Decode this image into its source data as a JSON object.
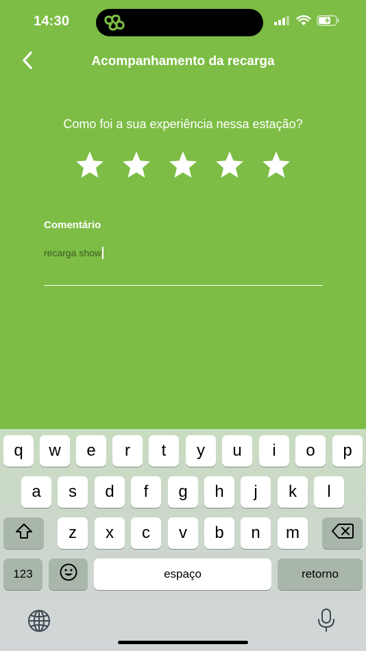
{
  "status_bar": {
    "time": "14:30",
    "icons": [
      "link-rings-icon",
      "cellular-signal-icon",
      "wifi-icon",
      "battery-charging-icon"
    ]
  },
  "header": {
    "title": "Acompanhamento da recarga",
    "back_icon": "chevron-left-icon"
  },
  "rating": {
    "question": "Como foi a sua experiência nessa estação?",
    "value": 5,
    "max": 5
  },
  "comment": {
    "label": "Comentário",
    "value": "recarga show"
  },
  "keyboard": {
    "row1": [
      "q",
      "w",
      "e",
      "r",
      "t",
      "y",
      "u",
      "i",
      "o",
      "p"
    ],
    "row2": [
      "a",
      "s",
      "d",
      "f",
      "g",
      "h",
      "j",
      "k",
      "l"
    ],
    "row3": [
      "z",
      "x",
      "c",
      "v",
      "b",
      "n",
      "m"
    ],
    "numbers_label": "123",
    "space_label": "espaço",
    "return_label": "retorno",
    "shift_icon": "shift-icon",
    "delete_icon": "backspace-icon",
    "emoji_icon": "emoji-icon",
    "globe_icon": "globe-icon",
    "mic_icon": "microphone-icon"
  },
  "colors": {
    "background": "#7dbd45",
    "accent_ring": "#7dbd45",
    "text": "#ffffff"
  }
}
